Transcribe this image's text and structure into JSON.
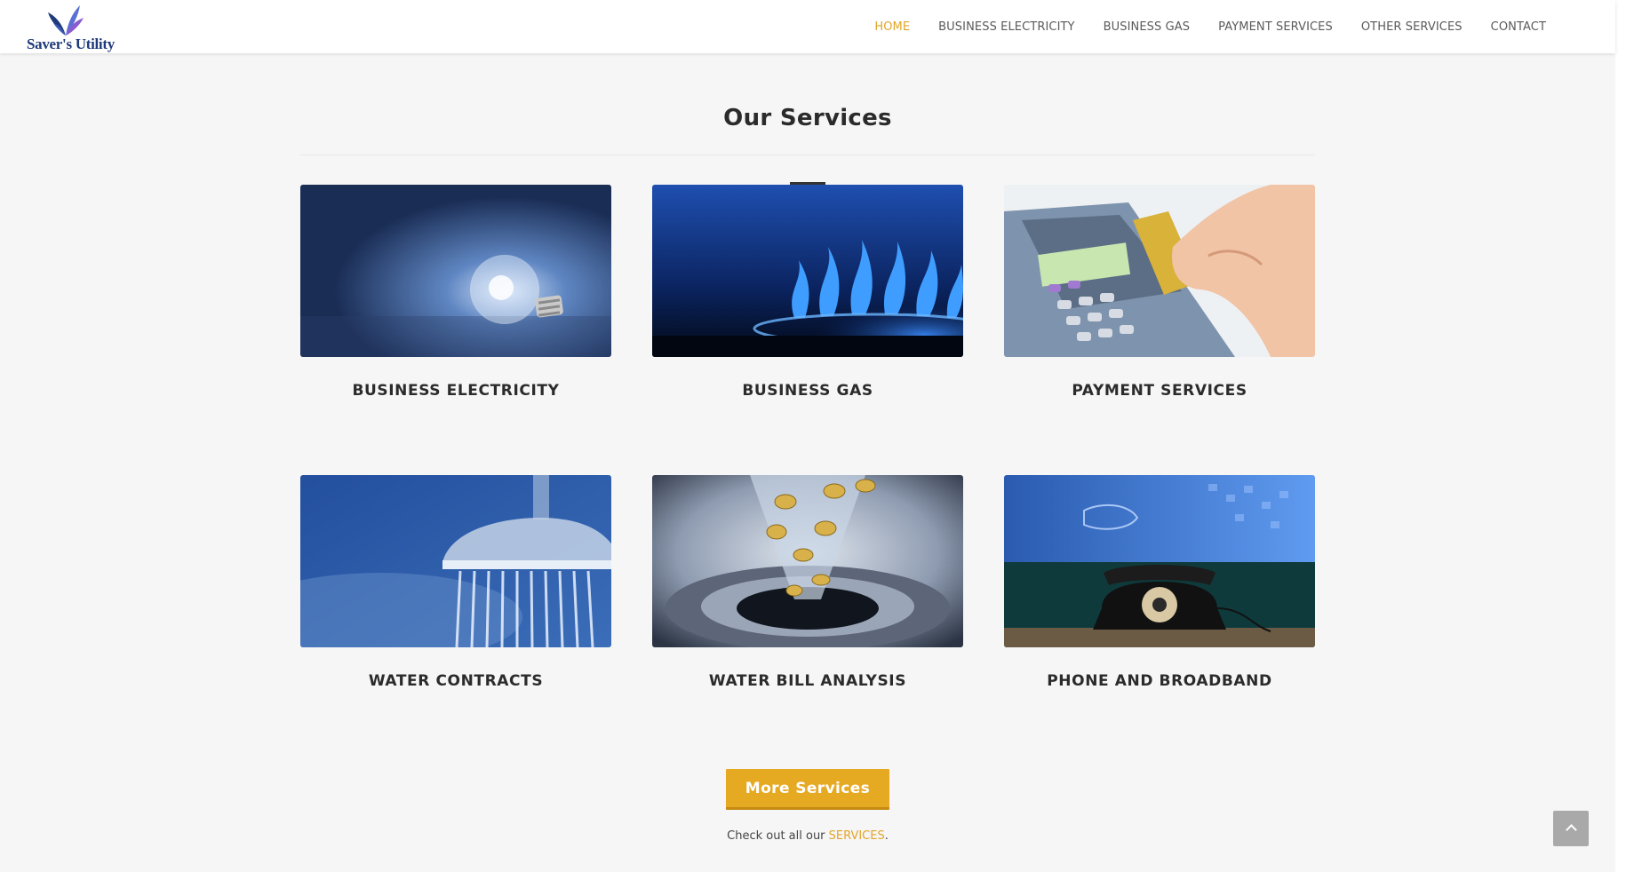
{
  "brand": {
    "logo_text": "Saver's Utility",
    "primary_color": "#1e3a7a",
    "accent_color": "#e2a52a"
  },
  "nav": {
    "items": [
      {
        "label": "HOME",
        "active": true
      },
      {
        "label": "BUSINESS ELECTRICITY",
        "active": false
      },
      {
        "label": "BUSINESS GAS",
        "active": false
      },
      {
        "label": "PAYMENT SERVICES",
        "active": false
      },
      {
        "label": "OTHER SERVICES",
        "active": false
      },
      {
        "label": "CONTACT",
        "active": false
      }
    ]
  },
  "services": {
    "title": "Our Services",
    "cards": [
      {
        "title": "BUSINESS ELECTRICITY",
        "image": "light-bulb"
      },
      {
        "title": "BUSINESS GAS",
        "image": "gas-flame"
      },
      {
        "title": "PAYMENT SERVICES",
        "image": "card-terminal"
      },
      {
        "title": "WATER CONTRACTS",
        "image": "shower-head"
      },
      {
        "title": "WATER BILL ANALYSIS",
        "image": "coins-drain"
      },
      {
        "title": "PHONE AND BROADBAND",
        "image": "rotary-phone"
      }
    ],
    "more_button": "More Services",
    "caption_prefix": "Check out all our ",
    "caption_link": "SERVICES",
    "caption_suffix": "."
  },
  "back_to_top": {
    "icon": "chevron-up-icon"
  }
}
